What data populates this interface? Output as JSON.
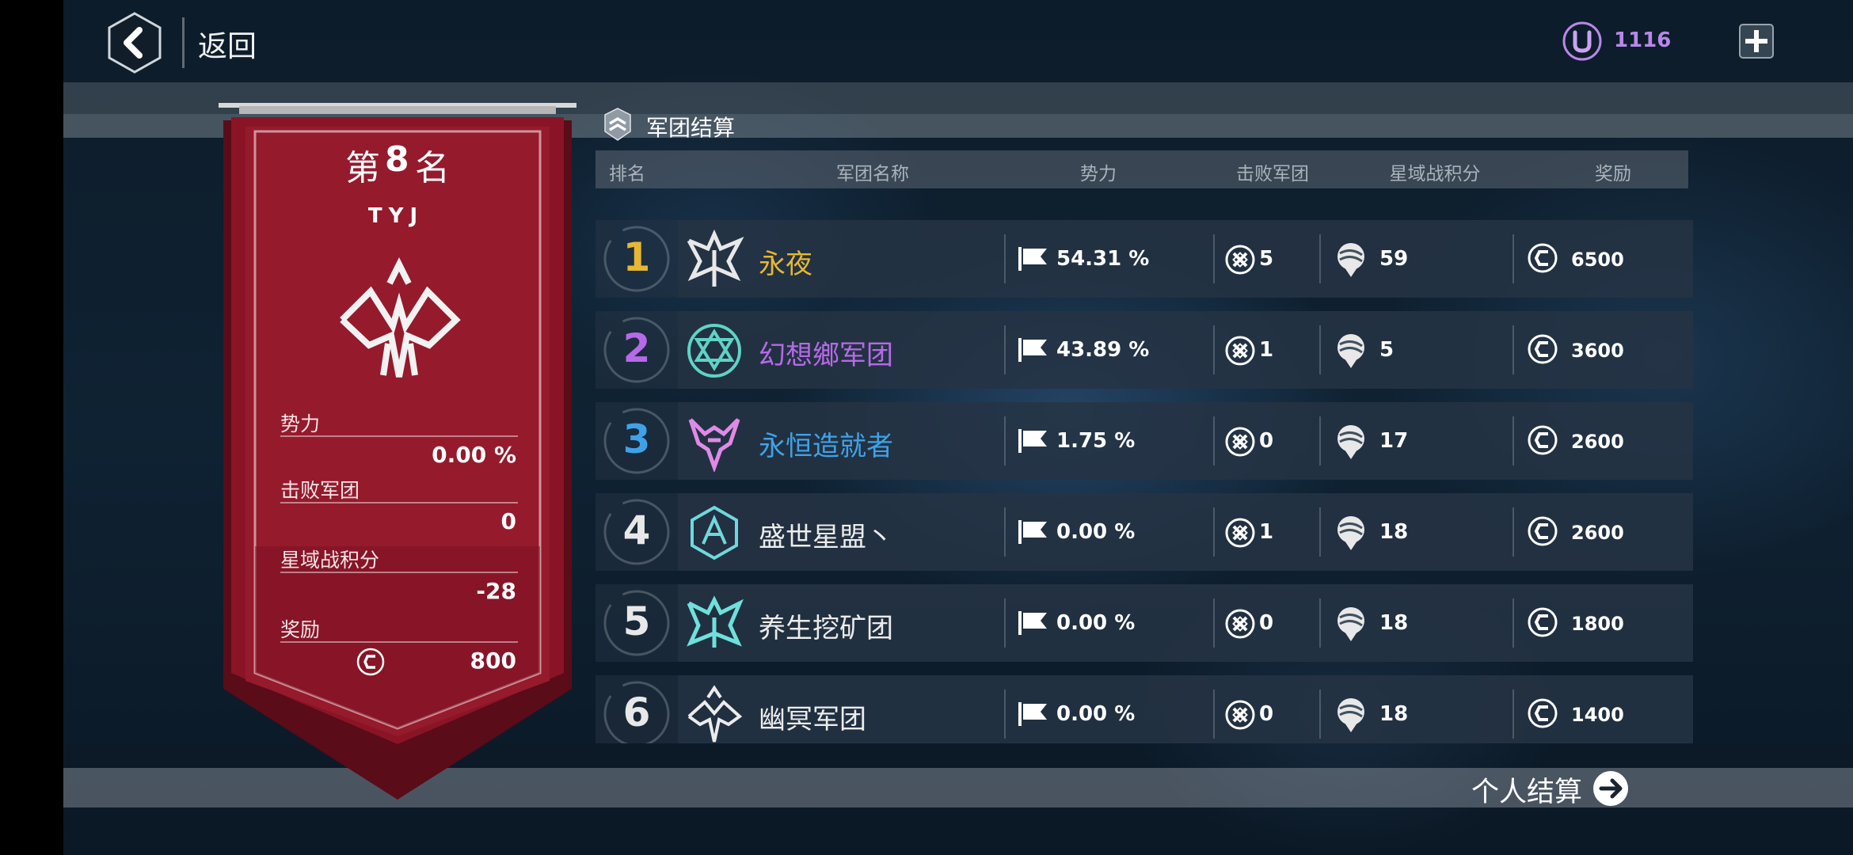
{
  "header": {
    "back_label": "返回",
    "currency_value": "1116",
    "currency_icon": "u-coin-icon",
    "plus_icon": "plus-icon"
  },
  "banner": {
    "rank_prefix": "第",
    "rank_number": "8",
    "rank_suffix": "名",
    "legion_name": "TYJ",
    "stats": [
      {
        "label": "势力",
        "value": "0.00 %"
      },
      {
        "label": "击败军团",
        "value": "0"
      },
      {
        "label": "星域战积分",
        "value": "-28"
      },
      {
        "label": "奖励",
        "value": "800"
      }
    ],
    "color": "#8a1426"
  },
  "section": {
    "title": "军团结算"
  },
  "table": {
    "headers": [
      "排名",
      "军团名称",
      "势力",
      "击败军团",
      "星域战积分",
      "奖励"
    ],
    "rows": [
      {
        "rank": "1",
        "name": "永夜",
        "influence": "54.31 %",
        "defeated": "5",
        "score": "59",
        "reward": "6500",
        "rank_color": "#e6b733",
        "name_color": "#e6b733"
      },
      {
        "rank": "2",
        "name": "幻想鄉军团",
        "influence": "43.89 %",
        "defeated": "1",
        "score": "5",
        "reward": "3600",
        "rank_color": "#b66ae8",
        "name_color": "#b66ae8"
      },
      {
        "rank": "3",
        "name": "永恒造就者",
        "influence": "1.75 %",
        "defeated": "0",
        "score": "17",
        "reward": "2600",
        "rank_color": "#3fa2e8",
        "name_color": "#3fa2e8"
      },
      {
        "rank": "4",
        "name": "盛世星盟丶",
        "influence": "0.00 %",
        "defeated": "1",
        "score": "18",
        "reward": "2600",
        "rank_color": "#e8e8e8",
        "name_color": "#ececec"
      },
      {
        "rank": "5",
        "name": "养生挖矿团",
        "influence": "0.00 %",
        "defeated": "0",
        "score": "18",
        "reward": "1800",
        "rank_color": "#e8e8e8",
        "name_color": "#ececec"
      },
      {
        "rank": "6",
        "name": "幽冥军团",
        "influence": "0.00 %",
        "defeated": "0",
        "score": "18",
        "reward": "1400",
        "rank_color": "#e8e8e8",
        "name_color": "#ececec"
      }
    ]
  },
  "footer": {
    "personal_label": "个人结算"
  }
}
